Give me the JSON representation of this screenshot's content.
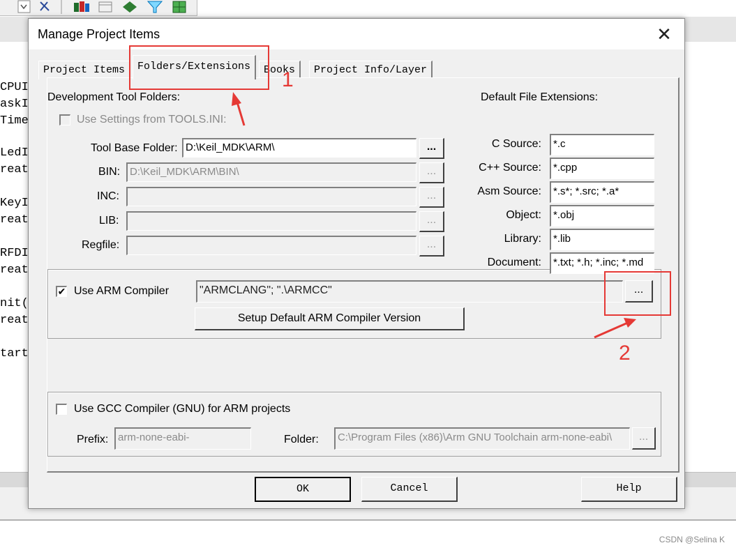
{
  "colors": {
    "annotation": "#e53935",
    "dialog_bg": "#f0f0f0"
  },
  "background": {
    "toolbar_icons": [
      "dropdown-icon",
      "wizard-icon",
      "books-icon",
      "window-icon",
      "diamond-icon",
      "filter-icon",
      "grid-icon"
    ],
    "code_fragments": [
      "CPUI",
      "askI",
      "Time",
      "LedI",
      "reat",
      "KeyI",
      "reat",
      "RFDI",
      "reat",
      "nit(",
      "reat",
      "tart"
    ]
  },
  "dialog": {
    "title": "Manage Project Items",
    "close_glyph": "✕",
    "tabs": [
      {
        "label": "Project Items"
      },
      {
        "label": "Folders/Extensions"
      },
      {
        "label": "Books"
      },
      {
        "label": "Project Info/Layer"
      }
    ],
    "dev_tool_folders": {
      "heading": "Development Tool Folders:",
      "use_tools_ini_label": "Use Settings from TOOLS.INI:",
      "tool_base_label": "Tool Base Folder:",
      "tool_base_value": "D:\\Keil_MDK\\ARM\\",
      "bin_label": "BIN:",
      "bin_value": "D:\\Keil_MDK\\ARM\\BIN\\",
      "inc_label": "INC:",
      "lib_label": "LIB:",
      "regfile_label": "Regfile:",
      "browse": "..."
    },
    "extensions": {
      "heading": "Default File Extensions:",
      "items": [
        {
          "label": "C Source:",
          "value": "*.c"
        },
        {
          "label": "C++ Source:",
          "value": "*.cpp"
        },
        {
          "label": "Asm Source:",
          "value": "*.s*; *.src; *.a*"
        },
        {
          "label": "Object:",
          "value": "*.obj"
        },
        {
          "label": "Library:",
          "value": "*.lib"
        },
        {
          "label": "Document:",
          "value": "*.txt; *.h; *.inc; *.md"
        }
      ]
    },
    "arm": {
      "checkbox_label": "Use ARM Compiler",
      "checked": true,
      "value": "\"ARMCLANG\"; \".\\ARMCC\"",
      "browse": "...",
      "setup_button": "Setup Default ARM Compiler Version"
    },
    "gcc": {
      "checkbox_label": "Use GCC Compiler (GNU) for ARM projects",
      "checked": false,
      "prefix_label": "Prefix:",
      "prefix_value": "arm-none-eabi-",
      "folder_label": "Folder:",
      "folder_value": "C:\\Program Files (x86)\\Arm GNU Toolchain arm-none-eabi\\",
      "browse": "..."
    },
    "buttons": {
      "ok": "OK",
      "cancel": "Cancel",
      "help": "Help"
    }
  },
  "annotations": {
    "one": "1",
    "two": "2"
  },
  "watermark": "CSDN @Selina K"
}
